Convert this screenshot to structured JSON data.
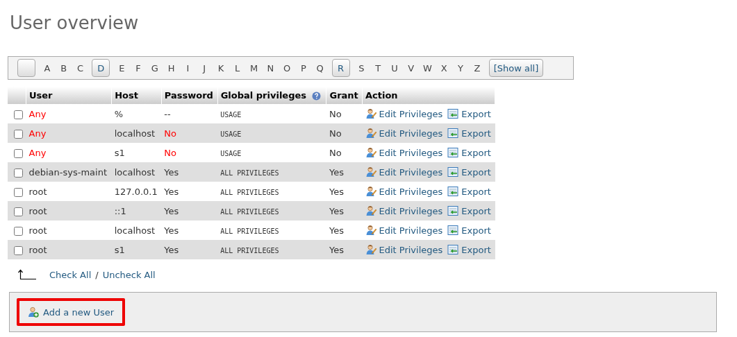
{
  "title": "User overview",
  "letters": [
    {
      "kind": "blank"
    },
    {
      "kind": "plain",
      "label": "A"
    },
    {
      "kind": "plain",
      "label": "B"
    },
    {
      "kind": "plain",
      "label": "C"
    },
    {
      "kind": "button",
      "label": "D"
    },
    {
      "kind": "plain",
      "label": "E"
    },
    {
      "kind": "plain",
      "label": "F"
    },
    {
      "kind": "plain",
      "label": "G"
    },
    {
      "kind": "plain",
      "label": "H"
    },
    {
      "kind": "plain",
      "label": "I"
    },
    {
      "kind": "plain",
      "label": "J"
    },
    {
      "kind": "plain",
      "label": "K"
    },
    {
      "kind": "plain",
      "label": "L"
    },
    {
      "kind": "plain",
      "label": "M"
    },
    {
      "kind": "plain",
      "label": "N"
    },
    {
      "kind": "plain",
      "label": "O"
    },
    {
      "kind": "plain",
      "label": "P"
    },
    {
      "kind": "plain",
      "label": "Q"
    },
    {
      "kind": "button",
      "label": "R"
    },
    {
      "kind": "plain",
      "label": "S"
    },
    {
      "kind": "plain",
      "label": "T"
    },
    {
      "kind": "plain",
      "label": "U"
    },
    {
      "kind": "plain",
      "label": "V"
    },
    {
      "kind": "plain",
      "label": "W"
    },
    {
      "kind": "plain",
      "label": "X"
    },
    {
      "kind": "plain",
      "label": "Y"
    },
    {
      "kind": "plain",
      "label": "Z"
    },
    {
      "kind": "button",
      "label": "[Show all]"
    }
  ],
  "table": {
    "columns": [
      "User",
      "Host",
      "Password",
      "Global privileges",
      "Grant",
      "Action"
    ],
    "rows": [
      {
        "checked": false,
        "user": "Any",
        "user_warning": true,
        "host": "%",
        "password": "--",
        "password_warning": false,
        "privileges": "USAGE",
        "grant": "No",
        "edit": "Edit Privileges",
        "export": "Export"
      },
      {
        "checked": false,
        "user": "Any",
        "user_warning": true,
        "host": "localhost",
        "password": "No",
        "password_warning": true,
        "privileges": "USAGE",
        "grant": "No",
        "edit": "Edit Privileges",
        "export": "Export"
      },
      {
        "checked": false,
        "user": "Any",
        "user_warning": true,
        "host": "s1",
        "password": "No",
        "password_warning": true,
        "privileges": "USAGE",
        "grant": "No",
        "edit": "Edit Privileges",
        "export": "Export"
      },
      {
        "checked": false,
        "user": "debian-sys-maint",
        "user_warning": false,
        "host": "localhost",
        "password": "Yes",
        "password_warning": false,
        "privileges": "ALL PRIVILEGES",
        "grant": "Yes",
        "edit": "Edit Privileges",
        "export": "Export"
      },
      {
        "checked": false,
        "user": "root",
        "user_warning": false,
        "host": "127.0.0.1",
        "password": "Yes",
        "password_warning": false,
        "privileges": "ALL PRIVILEGES",
        "grant": "Yes",
        "edit": "Edit Privileges",
        "export": "Export"
      },
      {
        "checked": false,
        "user": "root",
        "user_warning": false,
        "host": "::1",
        "password": "Yes",
        "password_warning": false,
        "privileges": "ALL PRIVILEGES",
        "grant": "Yes",
        "edit": "Edit Privileges",
        "export": "Export"
      },
      {
        "checked": false,
        "user": "root",
        "user_warning": false,
        "host": "localhost",
        "password": "Yes",
        "password_warning": false,
        "privileges": "ALL PRIVILEGES",
        "grant": "Yes",
        "edit": "Edit Privileges",
        "export": "Export"
      },
      {
        "checked": false,
        "user": "root",
        "user_warning": false,
        "host": "s1",
        "password": "Yes",
        "password_warning": false,
        "privileges": "ALL PRIVILEGES",
        "grant": "Yes",
        "edit": "Edit Privileges",
        "export": "Export"
      }
    ]
  },
  "check_all": "Check All",
  "separator": "/",
  "uncheck_all": "Uncheck All",
  "add_user": {
    "label": "Add a new User",
    "highlighted": true
  }
}
